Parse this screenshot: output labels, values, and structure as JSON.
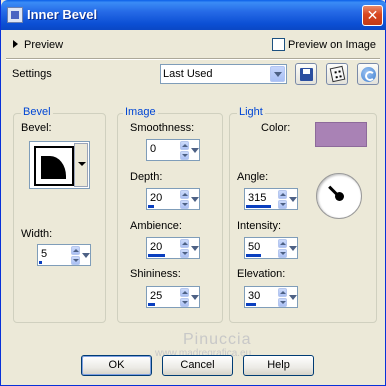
{
  "window": {
    "title": "Inner Bevel",
    "close": "✕"
  },
  "preview": {
    "toggle_label": "Preview",
    "checkbox_label": "Preview on Image",
    "checked": false
  },
  "settings": {
    "label": "Settings",
    "selected": "Last Used"
  },
  "bevel": {
    "group": "Bevel",
    "shape_label": "Bevel:",
    "width_label": "Width:",
    "width": "5",
    "width_fill": 0.1
  },
  "image": {
    "group": "Image",
    "smoothness_label": "Smoothness:",
    "smoothness": "0",
    "smoothness_fill": 0.0,
    "depth_label": "Depth:",
    "depth": "20",
    "depth_fill": 0.2,
    "ambience_label": "Ambience:",
    "ambience": "20",
    "ambience_fill": 0.6,
    "shininess_label": "Shininess:",
    "shininess": "25",
    "shininess_fill": 0.25
  },
  "light": {
    "group": "Light",
    "color_label": "Color:",
    "color": "#a982b5",
    "angle_label": "Angle:",
    "angle": "315",
    "angle_fill": 0.875,
    "intensity_label": "Intensity:",
    "intensity": "50",
    "intensity_fill": 0.5,
    "elevation_label": "Elevation:",
    "elevation": "30",
    "elevation_fill": 0.33
  },
  "watermark": {
    "line1": "Pinuccia",
    "line2": "www.madregrafica.eu"
  },
  "buttons": {
    "ok": "OK",
    "cancel": "Cancel",
    "help": "Help"
  }
}
